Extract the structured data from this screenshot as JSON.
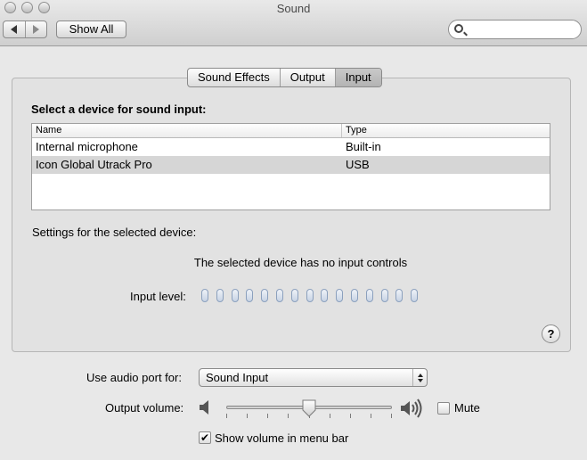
{
  "window": {
    "title": "Sound"
  },
  "toolbar": {
    "show_all_label": "Show All",
    "search_value": ""
  },
  "tabs": [
    {
      "label": "Sound Effects",
      "selected": false
    },
    {
      "label": "Output",
      "selected": false
    },
    {
      "label": "Input",
      "selected": true
    }
  ],
  "input": {
    "heading": "Select a device for sound input:",
    "columns": [
      "Name",
      "Type"
    ],
    "devices": [
      {
        "name": "Internal microphone",
        "type": "Built-in",
        "selected": false
      },
      {
        "name": "Icon Global Utrack Pro",
        "type": "USB",
        "selected": true
      }
    ],
    "settings_label": "Settings for the selected device:",
    "no_controls_text": "The selected device has no input controls",
    "input_level_label": "Input level:",
    "input_level_value": 0,
    "input_level_segments": 15
  },
  "footer": {
    "audio_port_label": "Use audio port for:",
    "audio_port_value": "Sound Input",
    "output_volume_label": "Output volume:",
    "output_volume_fraction": 0.5,
    "mute_label": "Mute",
    "mute_checked": false,
    "show_volume_label": "Show volume in menu bar",
    "show_volume_checked": true
  },
  "colors": {
    "selected_row": "#d6d6d6",
    "meter_segment": "#c7d3e4"
  }
}
